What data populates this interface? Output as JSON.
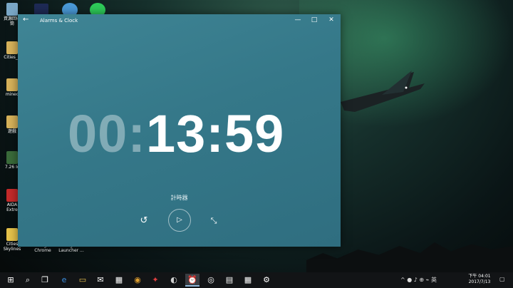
{
  "desktop": {
    "icons": [
      {
        "label": "資源回收筒",
        "color": "#7aa7c7"
      },
      {
        "label": "Cities_S",
        "color": "#d7b25a"
      },
      {
        "label": "minec",
        "color": "#d7b25a"
      },
      {
        "label": "遊戲",
        "color": "#d7b25a"
      },
      {
        "label": "7.26 Ic",
        "color": "#3a6b3a"
      },
      {
        "label": "AIDA Extre",
        "color": "#c42a2a"
      },
      {
        "label": "Cities Skylines",
        "color": "#e6c24a"
      }
    ],
    "bottom_icons": [
      {
        "label": "Google Chrome"
      },
      {
        "label": "Enigma Launcher ..."
      }
    ]
  },
  "window": {
    "title": "Alarms & Clock",
    "back_glyph": "←",
    "minimize_glyph": "—",
    "maximize_glyph": "□",
    "close_glyph": "✕",
    "timer": {
      "hours": "00",
      "sep1": ":",
      "minutes": "13",
      "sep2": ":",
      "seconds": "59"
    },
    "timer_label": "計時器",
    "reset_glyph": "↺",
    "play_glyph": "▷",
    "shrink_glyph": "⤡"
  },
  "taskbar": {
    "start_glyph": "⊞",
    "search_glyph": "⌕",
    "taskview_glyph": "❐",
    "apps": [
      {
        "name": "edge",
        "glyph": "e",
        "color": "#3b8ee0"
      },
      {
        "name": "file-explorer",
        "glyph": "▭",
        "color": "#e8c14e"
      },
      {
        "name": "mail",
        "glyph": "✉",
        "color": "#ffffff"
      },
      {
        "name": "store",
        "glyph": "▦",
        "color": "#ffffff"
      },
      {
        "name": "chrome",
        "glyph": "◉",
        "color": "#e0a030"
      },
      {
        "name": "game",
        "glyph": "✦",
        "color": "#e04040"
      },
      {
        "name": "paint",
        "glyph": "◐",
        "color": "#d0d0d0"
      },
      {
        "name": "alarms",
        "glyph": "⏰",
        "color": "#ffffff"
      },
      {
        "name": "groove",
        "glyph": "◎",
        "color": "#ffffff"
      },
      {
        "name": "movies",
        "glyph": "▤",
        "color": "#ffffff"
      },
      {
        "name": "calculator",
        "glyph": "▦",
        "color": "#ffffff"
      },
      {
        "name": "settings",
        "glyph": "⚙",
        "color": "#ffffff"
      }
    ],
    "tray_glyphs": "^ ● ♪ ⊕ ⌁ 英",
    "time": "下午 04:01",
    "date": "2017/7/13",
    "notification_glyph": "▢"
  }
}
